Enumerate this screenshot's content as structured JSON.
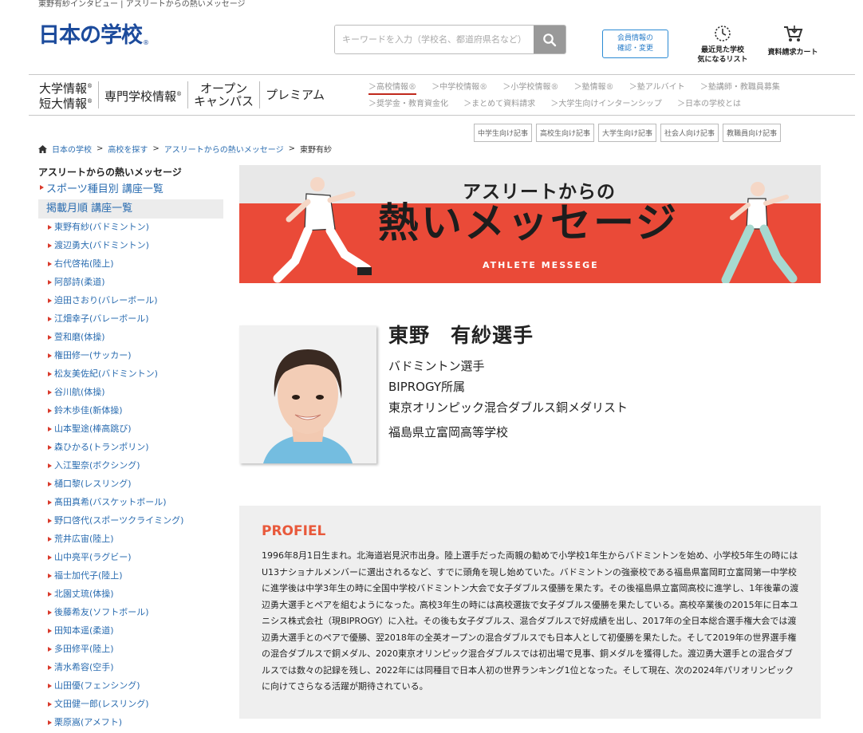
{
  "top": {
    "breadcrumb_line": "東野有紗インタビュー | アスリートからの熱いメッセージ"
  },
  "logo": {
    "text": "日本の学校",
    "r": "®"
  },
  "search": {
    "placeholder": "キーワードを入力（学校名、都道府県名など）"
  },
  "member": {
    "line1": "会員情報の",
    "line2": "確認・変更"
  },
  "recent": {
    "line1": "最近見た学校",
    "line2": "気になるリスト"
  },
  "cart": {
    "label": "資料請求カート"
  },
  "nav_main": [
    {
      "line1": "大学情報",
      "line2": "短大情報",
      "mark": "®"
    },
    {
      "line1": "専門学校情報",
      "line2": "",
      "mark": "®"
    },
    {
      "line1": "オープン",
      "line2": "キャンパス",
      "mark": ""
    },
    {
      "line1": "プレミアム",
      "line2": "",
      "mark": ""
    }
  ],
  "nav_sub": [
    "＞高校情報®",
    "＞中学校情報®",
    "＞小学校情報®",
    "＞塾情報®",
    "＞塾アルバイト",
    "＞塾講師・教職員募集",
    "＞奨学金・教育資金化",
    "＞まとめて資料請求",
    "＞大学生向けインターンシップ",
    "＞日本の学校とは"
  ],
  "article_buttons": [
    "中学生向け記事",
    "高校生向け記事",
    "大学生向け記事",
    "社会人向け記事",
    "教職員向け記事"
  ],
  "breadcrumb": {
    "home": "日本の学校",
    "b1": "高校を探す",
    "b2": "アスリートからの熱いメッセージ",
    "current": "東野有紗"
  },
  "sidebar": {
    "title": "アスリートからの熱いメッセージ",
    "head1": "スポーツ種目別 講座一覧",
    "head2": "掲載月順 講座一覧",
    "items": [
      "東野有紗(バドミントン)",
      "渡辺勇大(バドミントン)",
      "右代啓祐(陸上)",
      "阿部詩(柔道)",
      "迫田さおり(バレーボール)",
      "江畑幸子(バレーボール)",
      "萱和磨(体操)",
      "権田修一(サッカー)",
      "松友美佐紀(バドミントン)",
      "谷川航(体操)",
      "鈴木歩佳(新体操)",
      "山本聖途(棒高跳び)",
      "森ひかる(トランポリン)",
      "入江聖奈(ボクシング)",
      "樋口黎(レスリング)",
      "髙田真希(バスケットボール)",
      "野口啓代(スポーツクライミング)",
      "荒井広宙(陸上)",
      "山中亮平(ラグビー)",
      "福士加代子(陸上)",
      "北園丈琉(体操)",
      "後藤希友(ソフトボール)",
      "田知本遥(柔道)",
      "多田修平(陸上)",
      "清水希容(空手)",
      "山田優(フェンシング)",
      "文田健一郎(レスリング)",
      "栗原嵩(アメフト)"
    ]
  },
  "banner": {
    "line1": "アスリートからの",
    "line2": "熱いメッセージ",
    "sub": "ATHLETE MESSEGE"
  },
  "athlete": {
    "name": "東野　有紗選手",
    "line1": "バドミントン選手",
    "line2": "BIPROGY所属",
    "line3": "東京オリンピック混合ダブルス銅メダリスト",
    "school": "福島県立富岡高等学校"
  },
  "profile": {
    "title": "PROFIEL",
    "text": "1996年8月1日生まれ。北海道岩見沢市出身。陸上選手だった両親の勧めで小学校1年生からバドミントンを始め、小学校5年生の時にはU13ナショナルメンバーに選出されるなど、すでに頭角を現し始めていた。バドミントンの強豪校である福島県富岡町立富岡第一中学校に進学後は中学3年生の時に全国中学校バドミントン大会で女子ダブルス優勝を果たす。その後福島県立富岡高校に進学し、1年後輩の渡辺勇大選手とペアを組むようになった。高校3年生の時には高校選抜で女子ダブルス優勝を果たしている。高校卒業後の2015年に日本ユニシス株式会社（現BIPROGY）に入社。その後も女子ダブルス、混合ダブルスで好成績を出し、2017年の全日本総合選手権大会では渡辺勇大選手とのペアで優勝、翌2018年の全英オープンの混合ダブルスでも日本人として初優勝を果たした。そして2019年の世界選手権の混合ダブルスで銅メダル、2020東京オリンピック混合ダブルスでは初出場で見事、銅メダルを獲得した。渡辺勇大選手との混合ダブルスでは数々の記録を残し、2022年には同種目で日本人初の世界ランキング1位となった。そして現在、次の2024年パリオリンピックに向けてさらなる活躍が期待されている。"
  },
  "colors": {
    "brand_blue": "#1c4b9c",
    "link_blue": "#2a6cb0",
    "accent_red": "#ea4a38",
    "profile_orange": "#e8593b"
  }
}
